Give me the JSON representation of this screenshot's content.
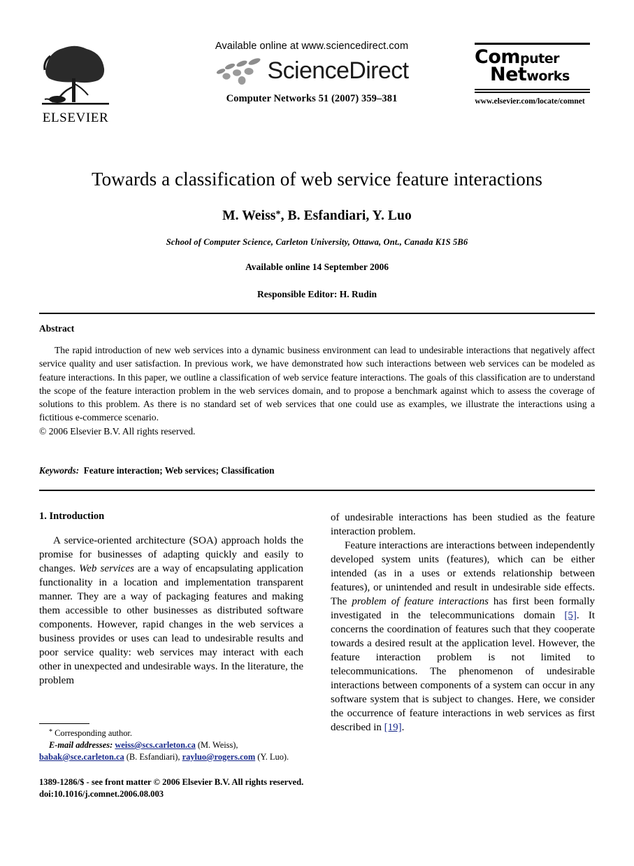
{
  "masthead": {
    "publisher_name": "ELSEVIER",
    "available_online": "Available online at www.sciencedirect.com",
    "sciencedirect_wordmark": "ScienceDirect",
    "journal_reference": "Computer Networks 51 (2007) 359–381",
    "journal_logo": {
      "line1_big": "C",
      "line1_mid": "om",
      "line1_rest": "puter",
      "line2_big": "N",
      "line2_mid": "et",
      "line2_rest": "works"
    },
    "journal_url": "www.elsevier.com/locate/comnet"
  },
  "title_block": {
    "title": "Towards a classification of web service feature interactions",
    "authors": "M. Weiss",
    "authors_rest": ", B. Esfandiari, Y. Luo",
    "corresponding_marker": "*",
    "affiliation": "School of Computer Science, Carleton University, Ottawa, Ont., Canada K1S 5B6",
    "available_online_date": "Available online 14 September 2006",
    "responsible_editor": "Responsible Editor: H. Rudin"
  },
  "abstract": {
    "heading": "Abstract",
    "text": "The rapid introduction of new web services into a dynamic business environment can lead to undesirable interactions that negatively affect service quality and user satisfaction. In previous work, we have demonstrated how such interactions between web services can be modeled as feature interactions. In this paper, we outline a classification of web service feature interactions. The goals of this classification are to understand the scope of the feature interaction problem in the web services domain, and to propose a benchmark against which to assess the coverage of solutions to this problem. As there is no standard set of web services that one could use as examples, we illustrate the interactions using a fictitious e-commerce scenario.",
    "copyright": "© 2006 Elsevier B.V. All rights reserved."
  },
  "keywords": {
    "label": "Keywords:",
    "values": "Feature interaction; Web services; Classification"
  },
  "body": {
    "section_heading": "1. Introduction",
    "left_par1_a": "A service-oriented architecture (SOA) approach holds the promise for businesses of adapting quickly and easily to changes. ",
    "left_par1_italic": "Web services",
    "left_par1_b": " are a way of encapsulating application functionality in a location and implementation transparent manner. They are a way of packaging features and making them accessible to other businesses as distributed software components. However, rapid changes in the web services a business provides or uses can lead to undesirable results and poor service quality: web services may interact with each other in unexpected and undesirable ways. In the literature, the problem",
    "right_par_cont": "of undesirable interactions has been studied as the feature interaction problem.",
    "right_par2_a": "Feature interactions are interactions between independently developed system units (features), which can be either intended (as in a uses or extends relationship between features), or unintended and result in undesirable side effects. The ",
    "right_par2_italic": "problem of feature interactions",
    "right_par2_b": " has first been formally investigated in the telecommunications domain ",
    "ref_5": "[5]",
    "right_par2_c": ". It concerns the coordination of features such that they cooperate towards a desired result at the application level. However, the feature interaction problem is not limited to telecommunications. The phenomenon of undesirable interactions between components of a system can occur in any software system that is subject to changes. Here, we consider the occurrence of feature interactions in web services as first described in ",
    "ref_19": "[19]",
    "right_par2_d": "."
  },
  "footnote": {
    "star": "*",
    "corresponding_author": "Corresponding author.",
    "email_label": "E-mail addresses:",
    "email1": "weiss@scs.carleton.ca",
    "email1_owner": "(M. Weiss),",
    "email2": "babak@sce.carleton.ca",
    "email2_owner": "(B. Esfandiari),",
    "email3": "rayluo@rogers.com",
    "email3_owner": "(Y. Luo)."
  },
  "page_footer": {
    "issn_line": "1389-1286/$ - see front matter © 2006 Elsevier B.V. All rights reserved.",
    "doi_line": "doi:10.1016/j.comnet.2006.08.003"
  },
  "colors": {
    "link": "#1a2b8c",
    "text": "#000000",
    "background": "#ffffff"
  }
}
